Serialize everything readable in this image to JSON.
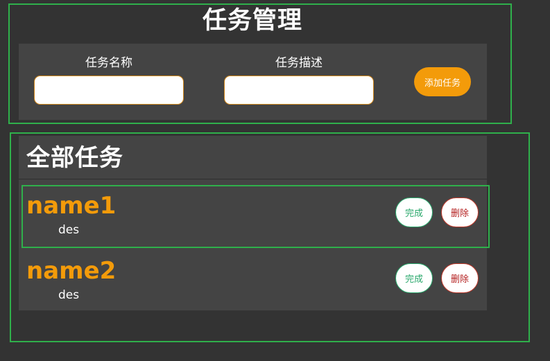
{
  "header": {
    "title": "任务管理"
  },
  "form": {
    "name_label": "任务名称",
    "name_value": "",
    "name_placeholder": "",
    "desc_label": "任务描述",
    "desc_value": "",
    "desc_placeholder": "",
    "add_button": "添加任务"
  },
  "list": {
    "title": "全部任务",
    "tasks": [
      {
        "name": "name1",
        "desc": "des",
        "done_label": "完成",
        "delete_label": "删除"
      },
      {
        "name": "name2",
        "desc": "des",
        "done_label": "完成",
        "delete_label": "删除"
      }
    ]
  },
  "colors": {
    "background": "#333333",
    "panel": "#444444",
    "accent": "#f39b0a",
    "outline": "#2fb04b",
    "done": "#2aa86c",
    "delete": "#b52222"
  }
}
